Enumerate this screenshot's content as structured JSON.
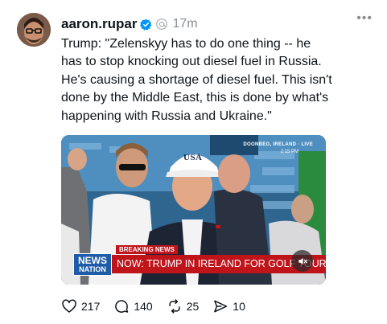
{
  "post": {
    "username": "aaron.rupar",
    "time": "17m",
    "text": "Trump: \"Zelenskyy has to do one thing -- he has to stop knocking out diesel fuel in Russia. He's causing a shortage of diesel fuel. This isn't done by the Middle East, this is done by what's happening with Russia and Ukraine.\""
  },
  "video": {
    "breaking_label": "BREAKING NEWS",
    "ticker_text": "NOW: TRUMP IN IRELAND FOR GOLF TOURNAMENT",
    "network_line1": "NEWS",
    "network_line2": "NATION",
    "locator": "DOONBEG, IRELAND · LIVE",
    "clock": "2:15 PM",
    "hat_text": "USA"
  },
  "actions": {
    "likes": "217",
    "replies": "140",
    "reposts": "25",
    "shares": "10"
  },
  "colors": {
    "accent_blue": "#0095f6",
    "ticker_red": "#c0141b",
    "network_blue": "#1e5ba8",
    "muted_text": "#8a8d91"
  },
  "icons": [
    "more-icon",
    "verified-badge-icon",
    "threads-icon",
    "heart-icon",
    "comment-icon",
    "repost-icon",
    "share-icon",
    "mute-icon"
  ]
}
